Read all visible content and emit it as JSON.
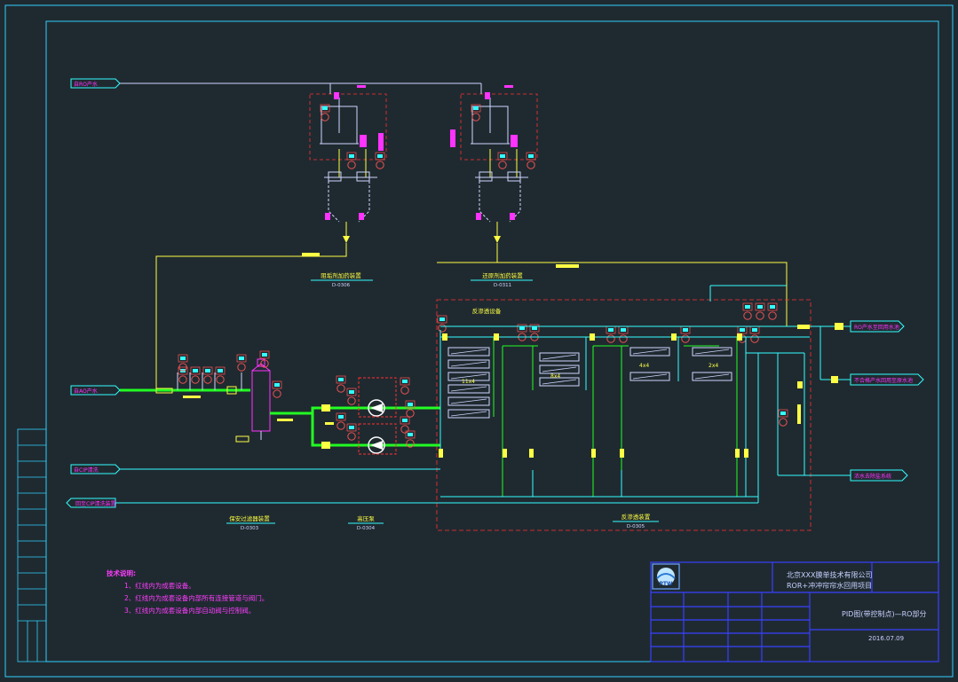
{
  "title_block": {
    "company_line1": "北京XXX膜单技术有限公司",
    "company_line2": "ROR+冲冲帘帘水回用项目",
    "drawing_title": "PID图(带控制点)—RO部分",
    "date": "2016.07.09",
    "logo_text": "PTW"
  },
  "units": {
    "tank1": {
      "name": "阻垢剂加药装置",
      "code": "D-0306"
    },
    "tank2": {
      "name": "还原剂加药装置",
      "code": "D-0311"
    },
    "cartridge": {
      "name": "保安过滤器装置",
      "code": "D-0303"
    },
    "pump": {
      "name": "高压泵",
      "code": "D-0304"
    },
    "ro": {
      "name": "反渗透装置",
      "code": "D-0305"
    },
    "main_device": "反渗透设备"
  },
  "streams": {
    "top_in": "自RO产水",
    "feed_in": "自AO产水",
    "clean_in": "自CIP清洗",
    "clean_out": "回至CIP清洗装置",
    "permeate_out": "RO产水至回用水池",
    "reject_out": "不合格产水回用至原水池",
    "concentrate_out": "浓水去除盐系统"
  },
  "stage_labels": [
    "11x4",
    "8x4",
    "4x4",
    "2x4"
  ],
  "notes": {
    "heading": "技术说明:",
    "items": [
      "1、红线内为成套设备。",
      "2、红线内为成套设备内部所有连接管道与阀门。",
      "3、红线内为成套设备内部自动阀与控制阀。"
    ]
  },
  "colors": {
    "background": "#1f2a30",
    "frame": "#2fd0ff",
    "process_line": "#33ffff",
    "feed_line": "#22ff22",
    "chem_line": "#ffff44",
    "tag": "#ff33ff",
    "red_boundary": "#ff3030",
    "title_block": "#3840ff"
  }
}
